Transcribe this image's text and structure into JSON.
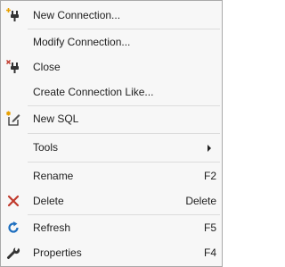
{
  "menu": {
    "items": [
      {
        "label": "New Connection...",
        "icon": "plug-plus-icon"
      },
      {
        "label": "Modify Connection..."
      },
      {
        "label": "Close",
        "icon": "plug-close-icon"
      },
      {
        "label": "Create Connection Like..."
      },
      {
        "label": "New SQL",
        "icon": "sql-editor-icon"
      },
      {
        "label": "Tools",
        "has_submenu": true
      },
      {
        "label": "Rename",
        "shortcut": "F2"
      },
      {
        "label": "Delete",
        "shortcut": "Delete",
        "icon": "delete-x-icon"
      },
      {
        "label": "Refresh",
        "shortcut": "F5",
        "icon": "refresh-icon"
      },
      {
        "label": "Properties",
        "shortcut": "F4",
        "icon": "wrench-icon"
      }
    ]
  },
  "colors": {
    "menu_background": "#f7f7f7",
    "border": "#a9a9a9",
    "separator": "#dcdcdc",
    "delete_red": "#c0392b",
    "refresh_blue": "#1e6fbf",
    "plus_yellow": "#e8a000",
    "text": "#1e1e1e"
  }
}
